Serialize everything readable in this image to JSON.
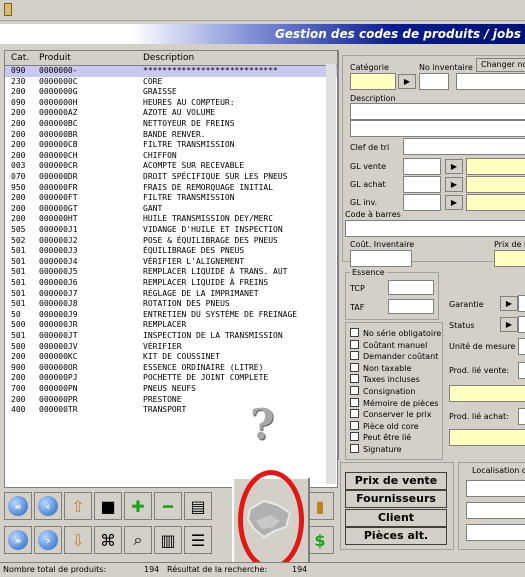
{
  "window": {
    "title": ""
  },
  "banner": {
    "title": "Gestion des codes de produits / jobs"
  },
  "grid": {
    "columns": [
      "Cat.",
      "Produit",
      "Description"
    ],
    "rows": [
      [
        "090",
        "0000000-",
        "****************************"
      ],
      [
        "230",
        "0000000C",
        "CORE"
      ],
      [
        "200",
        "0000000G",
        "GRAISSE"
      ],
      [
        "090",
        "0000000H",
        "HEURES AU COMPTEUR:"
      ],
      [
        "200",
        "000000AZ",
        "AZOTE AU VOLUME"
      ],
      [
        "200",
        "000000BC",
        "NETTOYEUR DE FREINS"
      ],
      [
        "200",
        "000000BR",
        "BANDE RENVER."
      ],
      [
        "200",
        "000000CB",
        "FILTRE TRANSMISSION"
      ],
      [
        "200",
        "000000CH",
        "CHIFFON"
      ],
      [
        "003",
        "000000CR",
        "ACOMPTE SUR RECEVABLE"
      ],
      [
        "070",
        "000000DR",
        "DROIT SPÉCIFIQUE SUR LES PNEUS"
      ],
      [
        "950",
        "000000FR",
        "FRAIS DE REMORQUAGE INITIAL"
      ],
      [
        "200",
        "000000FT",
        "FILTRE TRANSMISSION"
      ],
      [
        "200",
        "000000GT",
        "GANT"
      ],
      [
        "200",
        "000000HT",
        "HUILE TRANSMISSION DEY/MERC"
      ],
      [
        "505",
        "000000J1",
        "VIDANGE D'HUILE ET INSPECTION"
      ],
      [
        "502",
        "000000J2",
        "POSE & ÉQUILIBRAGE DES PNEUS"
      ],
      [
        "501",
        "000000J3",
        "ÉQUILIBRAGE DES PNEUS"
      ],
      [
        "501",
        "000000J4",
        "VÉRIFIER L'ALIGNEMENT"
      ],
      [
        "501",
        "000000J5",
        "REMPLACER LIQUIDE À TRANS. AUT"
      ],
      [
        "501",
        "000000J6",
        "REMPLACER LIQUIDE À FREINS"
      ],
      [
        "501",
        "000000J7",
        "RÉGLAGE DE LA IMPRIMANET"
      ],
      [
        "501",
        "000000J8",
        "ROTATION DES PNEUS"
      ],
      [
        "50",
        "000000J9",
        "ENTRETIEN DU SYSTÈME DE FREINAGE"
      ],
      [
        "500",
        "000000JR",
        "REMPLACER"
      ],
      [
        "501",
        "000000JT",
        "INSPECTION DE LA TRANSMISSION"
      ],
      [
        "500",
        "000000JV",
        "VÉRIFIER"
      ],
      [
        "200",
        "000000KC",
        "KIT DE COUSSINET"
      ],
      [
        "900",
        "000000OR",
        "ESSENCE ORDINAIRE (LITRE)"
      ],
      [
        "200",
        "000000PJ",
        "POCHETTE DE JOINT COMPLETE"
      ],
      [
        "700",
        "000000PN",
        "PNEUS NEUFS"
      ],
      [
        "200",
        "000000PR",
        "PRESTONE"
      ],
      [
        "400",
        "000000TR",
        "TRANSPORT"
      ]
    ]
  },
  "overlay": {
    "question": "?"
  },
  "form": {
    "categorie": "Catégorie",
    "no_inventaire": "No inventaire",
    "changer": "Changer no",
    "description": "Description",
    "clef_tri": "Clef de tri",
    "gl_vente": "GL vente",
    "gl_achat": "GL achat",
    "gl_inv": "GL inv.",
    "code_barres": "Code à barres",
    "cout_inventaire": "Coût. Inventaire",
    "prix": "Prix de li",
    "essence": "Essence",
    "tcp": "TCP",
    "taf": "TAF",
    "garantie": "Garantie",
    "status": "Status",
    "unite": "Unité de mesure",
    "prod_vente": "Prod. lié vente:",
    "prod_achat": "Prod. lié achat:",
    "localisation": "Localisation d'"
  },
  "checkboxes": [
    "No série obligatoire",
    "Coûtant manuel",
    "Demander coûtant",
    "Non taxable",
    "Taxes incluses",
    "Consignation",
    "Mémoire de pièces",
    "Conserver le prix",
    "Pièce old core",
    "Peut être lié",
    "Signature"
  ],
  "buttons": {
    "prix_vente": "Prix de vente",
    "fournisseurs": "Fournisseurs",
    "client": "Client",
    "pieces_alt": "Pièces alt."
  },
  "status": {
    "total_label": "Nombre total de produits:",
    "total_value": "194",
    "result_label": "Résultat de la recherche:",
    "result_value": "194"
  },
  "colors": {
    "banner_dark": "#001070",
    "selected_row": "#c8c8f0",
    "input_yellow": "#ffffc0",
    "circle_red": "#e01818"
  }
}
